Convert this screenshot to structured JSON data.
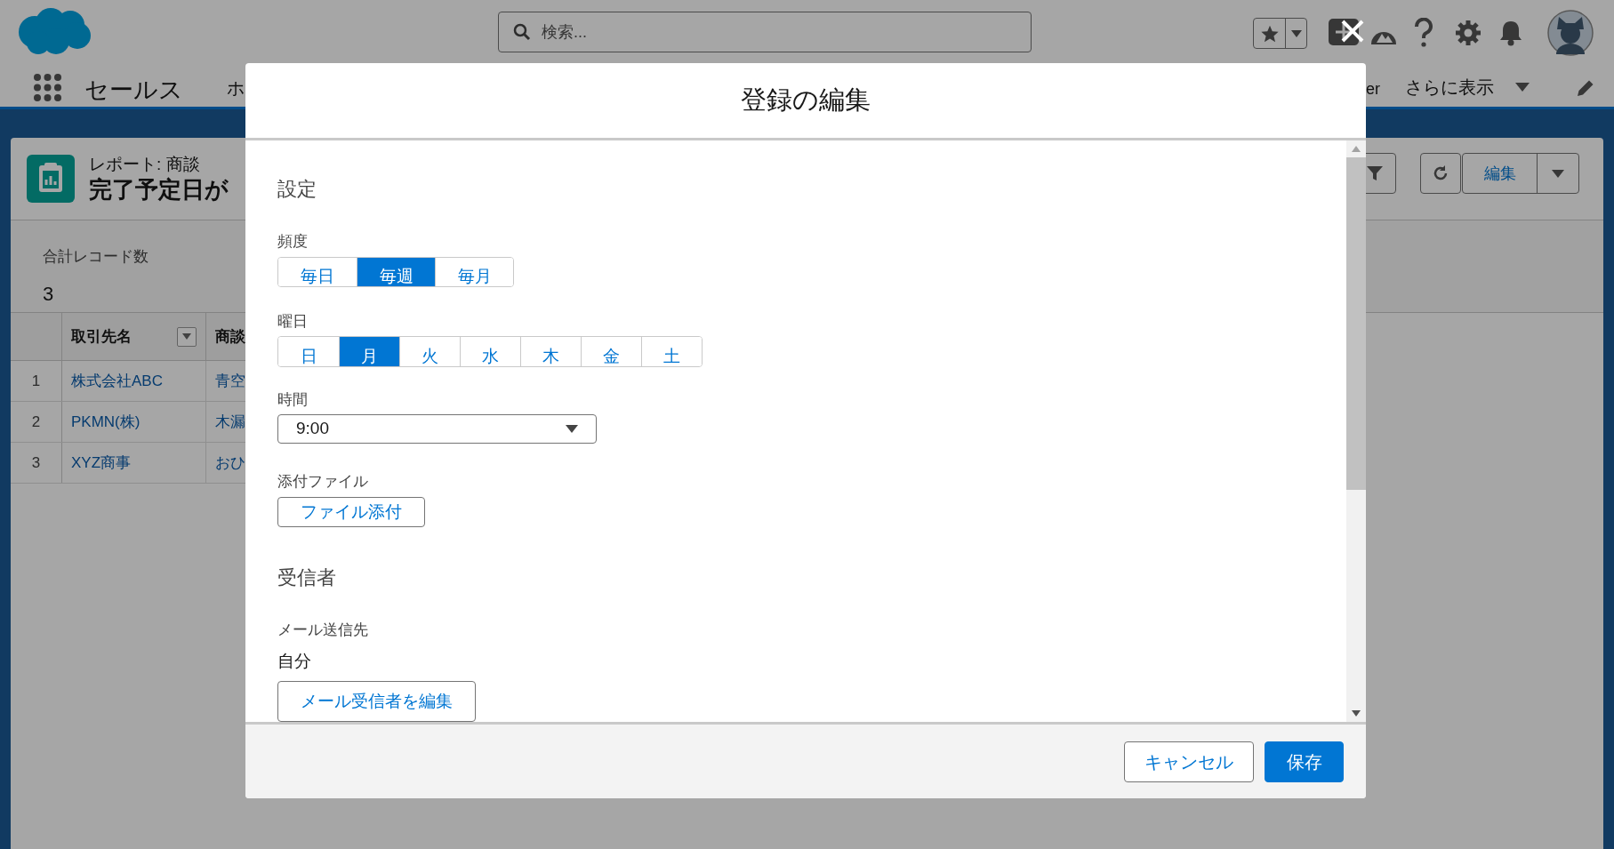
{
  "header": {
    "search": {
      "placeholder": "検索..."
    },
    "app_name": "セールス",
    "nav_items": [
      {
        "label": "ホ"
      },
      {
        "label": "er"
      }
    ],
    "more_label": "さらに表示"
  },
  "report": {
    "subtitle": "レポート: 商談",
    "title": "完了予定日が",
    "edit_button": "編集",
    "summary_label": "合計レコード数",
    "summary_value": "3",
    "table": {
      "columns": [
        "取引先名",
        "商談"
      ],
      "rows": [
        {
          "number": "1",
          "cells": [
            "株式会社ABC",
            "青空"
          ]
        },
        {
          "number": "2",
          "cells": [
            "PKMN(株)",
            "木漏"
          ]
        },
        {
          "number": "3",
          "cells": [
            "XYZ商事",
            "おひ"
          ]
        }
      ]
    }
  },
  "modal": {
    "title": "登録の編集",
    "settings_heading": "設定",
    "frequency": {
      "label": "頻度",
      "options": [
        {
          "label": "毎日",
          "selected": false
        },
        {
          "label": "毎週",
          "selected": true
        },
        {
          "label": "毎月",
          "selected": false
        }
      ]
    },
    "weekday": {
      "label": "曜日",
      "options": [
        {
          "label": "日",
          "selected": false
        },
        {
          "label": "月",
          "selected": true
        },
        {
          "label": "火",
          "selected": false
        },
        {
          "label": "水",
          "selected": false
        },
        {
          "label": "木",
          "selected": false
        },
        {
          "label": "金",
          "selected": false
        },
        {
          "label": "土",
          "selected": false
        }
      ]
    },
    "time": {
      "label": "時間",
      "value": "9:00"
    },
    "attachment": {
      "label": "添付ファイル",
      "button": "ファイル添付"
    },
    "recipients_heading": "受信者",
    "email": {
      "label": "メール送信先",
      "value": "自分",
      "button": "メール受信者を編集"
    },
    "buttons": [
      {
        "label": "キャンセル",
        "kind": "neutral"
      },
      {
        "label": "保存",
        "kind": "brand"
      }
    ]
  }
}
